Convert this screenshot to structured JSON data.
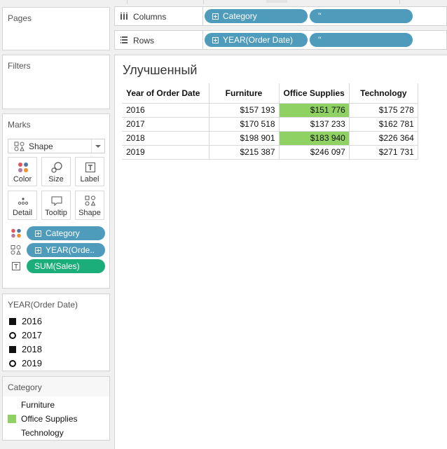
{
  "panels": {
    "pages": "Pages",
    "filters": "Filters",
    "marks": "Marks"
  },
  "marks": {
    "type": "Shape",
    "buttons": [
      {
        "name": "color",
        "label": "Color"
      },
      {
        "name": "size",
        "label": "Size"
      },
      {
        "name": "label",
        "label": "Label"
      },
      {
        "name": "detail",
        "label": "Detail"
      },
      {
        "name": "tooltip",
        "label": "Tooltip"
      },
      {
        "name": "shape",
        "label": "Shape"
      }
    ],
    "fields": [
      {
        "icon": "color-dots-icon",
        "label": "Category",
        "kind": "dimension"
      },
      {
        "icon": "shape-icon",
        "label": "YEAR(Orde..",
        "kind": "dimension"
      },
      {
        "icon": "text-icon",
        "label": "SUM(Sales)",
        "kind": "measure"
      }
    ]
  },
  "shelves": {
    "columns": {
      "label": "Columns",
      "pills": [
        "Category",
        "''"
      ]
    },
    "rows": {
      "label": "Rows",
      "pills": [
        "YEAR(Order Date)",
        "''"
      ]
    }
  },
  "legends": {
    "year": {
      "title": "YEAR(Order Date)",
      "items": [
        {
          "label": "2016",
          "shape": "filled-square"
        },
        {
          "label": "2017",
          "shape": "open-circle"
        },
        {
          "label": "2018",
          "shape": "filled-square"
        },
        {
          "label": "2019",
          "shape": "open-circle"
        }
      ]
    },
    "category": {
      "title": "Category",
      "items": [
        {
          "label": "Furniture",
          "color": ""
        },
        {
          "label": "Office Supplies",
          "color": "#8fd163"
        },
        {
          "label": "Technology",
          "color": ""
        }
      ]
    }
  },
  "viz": {
    "title": "Улучшенный",
    "row_header": "Year of Order Date",
    "columns": [
      "Furniture",
      "Office Supplies",
      "Technology"
    ],
    "rows": [
      {
        "year": "2016",
        "values": [
          "$157 193",
          "$151 776",
          "$175 278"
        ],
        "highlight": [
          false,
          true,
          false
        ]
      },
      {
        "year": "2017",
        "values": [
          "$170 518",
          "$137 233",
          "$162 781"
        ],
        "highlight": [
          false,
          false,
          false
        ]
      },
      {
        "year": "2018",
        "values": [
          "$198 901",
          "$183 940",
          "$226 364"
        ],
        "highlight": [
          false,
          true,
          false
        ]
      },
      {
        "year": "2019",
        "values": [
          "$215 387",
          "$246 097",
          "$271 731"
        ],
        "highlight": [
          false,
          false,
          false
        ]
      }
    ]
  },
  "colors": {
    "pill_dimension": "#4e9bbb",
    "pill_measure": "#1bae7b",
    "highlight": "#8fd163"
  }
}
